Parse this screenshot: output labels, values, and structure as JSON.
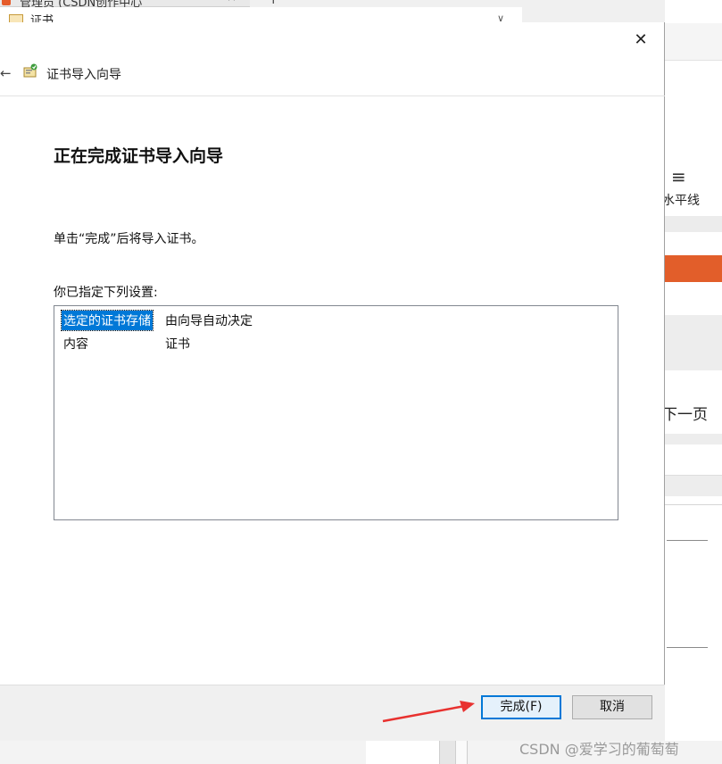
{
  "background": {
    "browser_tab_title": "管理员 (CSDN创作中心",
    "browser_tab_close": "×",
    "browser_new_tab": "+",
    "cert_window_title": "证书",
    "cert_window_chevron": "∨",
    "right_panel": {
      "menu_icon": "≡",
      "menu_label": "水平线",
      "page_text": "下一页"
    }
  },
  "dialog": {
    "close_glyph": "✕",
    "back_glyph": "←",
    "wizard_title": "证书导入向导",
    "heading": "正在完成证书导入向导",
    "instruction": "单击“完成”后将导入证书。",
    "settings_label": "你已指定下列设置:",
    "settings": [
      {
        "key": "选定的证书存储",
        "value": "由向导自动决定"
      },
      {
        "key": "内容",
        "value": "证书"
      }
    ],
    "buttons": {
      "finish": "完成(F)",
      "cancel": "取消"
    }
  },
  "annotation_color": "#e8312f",
  "watermark": "CSDN @爱学习的葡萄萄"
}
